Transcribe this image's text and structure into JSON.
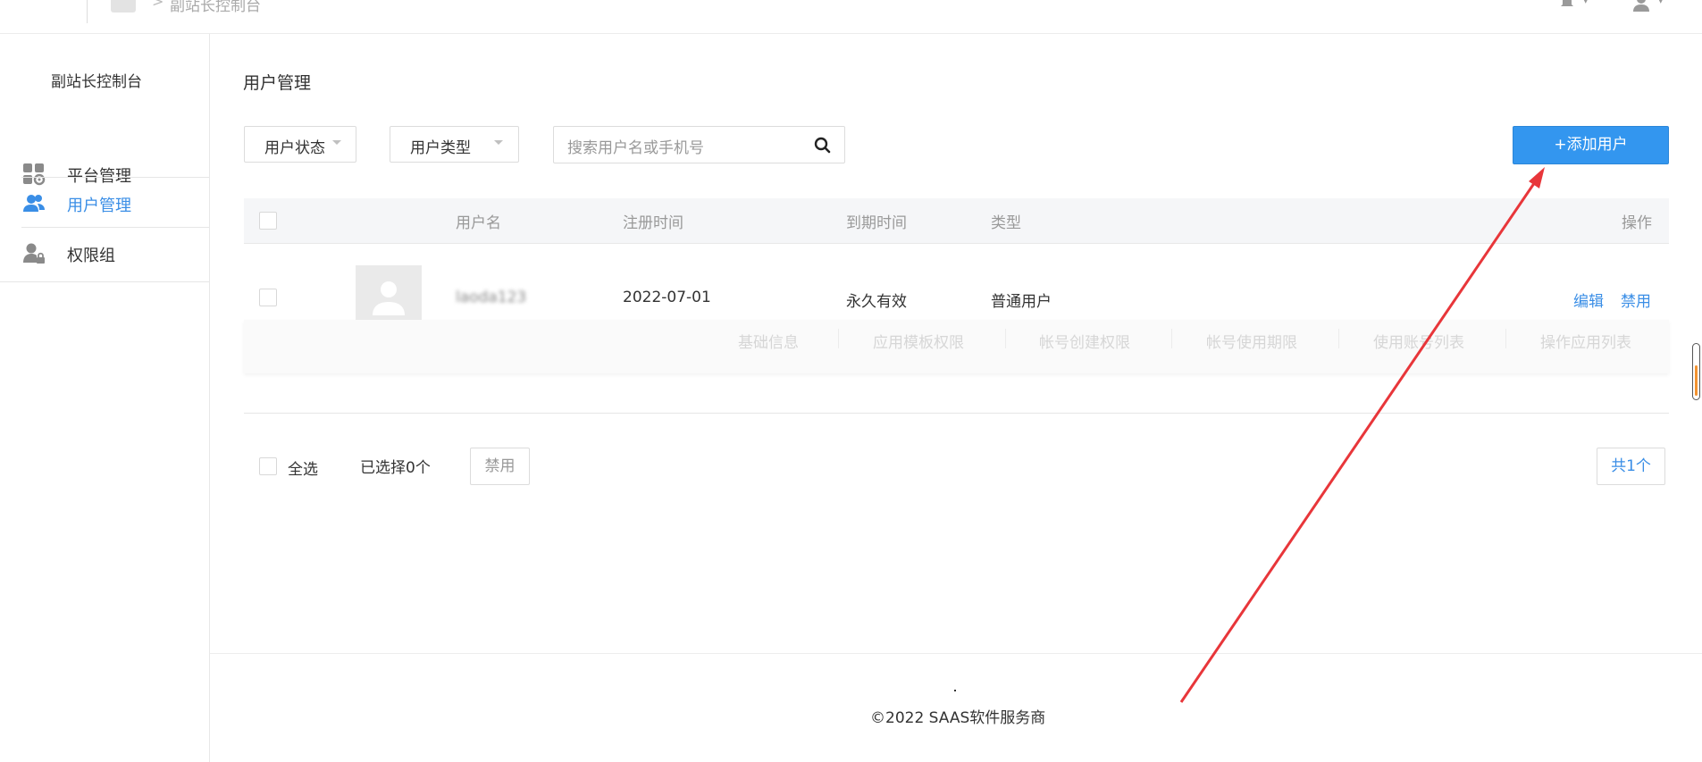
{
  "topbar": {
    "breadcrumb_sep": ">",
    "breadcrumb": "副站长控制台"
  },
  "sidebar": {
    "title": "副站长控制台",
    "items": [
      {
        "label": "平台管理",
        "icon": "grid-gear-icon"
      },
      {
        "label": "用户管理",
        "icon": "users-icon",
        "active": true
      },
      {
        "label": "权限组",
        "icon": "user-lock-icon"
      }
    ]
  },
  "main": {
    "title": "用户管理",
    "filters": {
      "status_label": "用户状态",
      "type_label": "用户类型"
    },
    "search": {
      "placeholder": "搜索用户名或手机号"
    },
    "add_button": "+添加用户",
    "table": {
      "columns": [
        "用户名",
        "注册时间",
        "到期时间",
        "类型",
        "操作"
      ],
      "rows": [
        {
          "username": "laoda123",
          "registered": "2022-07-01",
          "expiry": "永久有效",
          "type": "普通用户",
          "actions": [
            "编辑",
            "禁用"
          ],
          "subtabs": [
            "基础信息",
            "应用模板权限",
            "帐号创建权限",
            "帐号使用期限",
            "使用账号列表",
            "操作应用列表"
          ]
        }
      ]
    },
    "bulk": {
      "select_all": "全选",
      "selected_count": "已选择0个",
      "disable_button": "禁用",
      "total": "共1个"
    }
  },
  "footer": {
    "dot": ".",
    "copyright": "©2022 SAAS软件服务商"
  },
  "colors": {
    "accent": "#3396ef",
    "link": "#3a8ee6",
    "annotation_arrow": "#e8363a"
  }
}
